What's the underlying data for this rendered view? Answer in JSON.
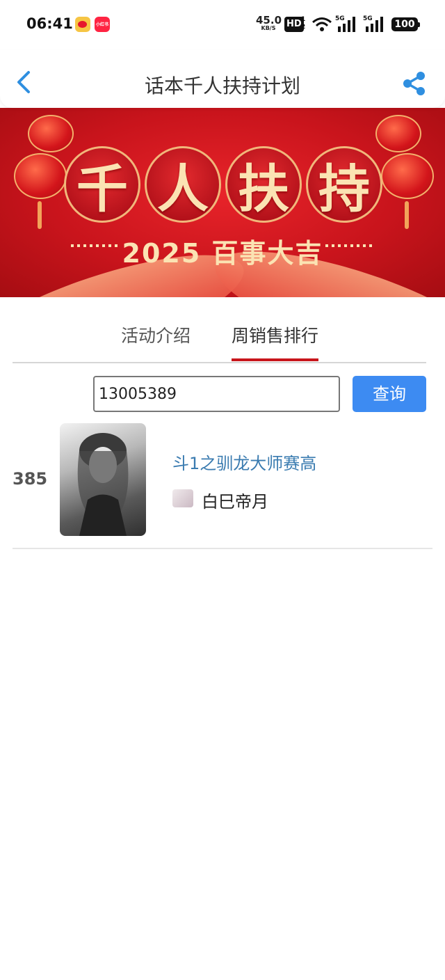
{
  "status_bar": {
    "time": "06:41",
    "apps": [
      "weibo-icon",
      "xiaohongshu-icon"
    ],
    "xhs_label": "小红书",
    "net_speed_value": "45.0",
    "net_speed_unit": "KB/S",
    "hd_label": "HD",
    "hd_sub": "1\n2",
    "signal_label": "5G",
    "battery": "100"
  },
  "nav": {
    "title": "话本千人扶持计划",
    "back_icon": "chevron-left-icon",
    "share_icon": "share-icon"
  },
  "banner": {
    "chars": [
      "千",
      "人",
      "扶",
      "持"
    ],
    "subtitle": "2025 百事大吉"
  },
  "tabs": [
    {
      "label": "活动介绍",
      "active": false
    },
    {
      "label": "周销售排行",
      "active": true
    }
  ],
  "colors": {
    "accent_blue": "#3d8bf2",
    "tab_active": "#c8151b",
    "link": "#3a7bb0"
  },
  "search": {
    "value": "13005389",
    "placeholder": "",
    "button_label": "查询"
  },
  "results": [
    {
      "rank": "385",
      "title": "斗1之驯龙大师赛高",
      "author": "白巳帝月"
    }
  ]
}
